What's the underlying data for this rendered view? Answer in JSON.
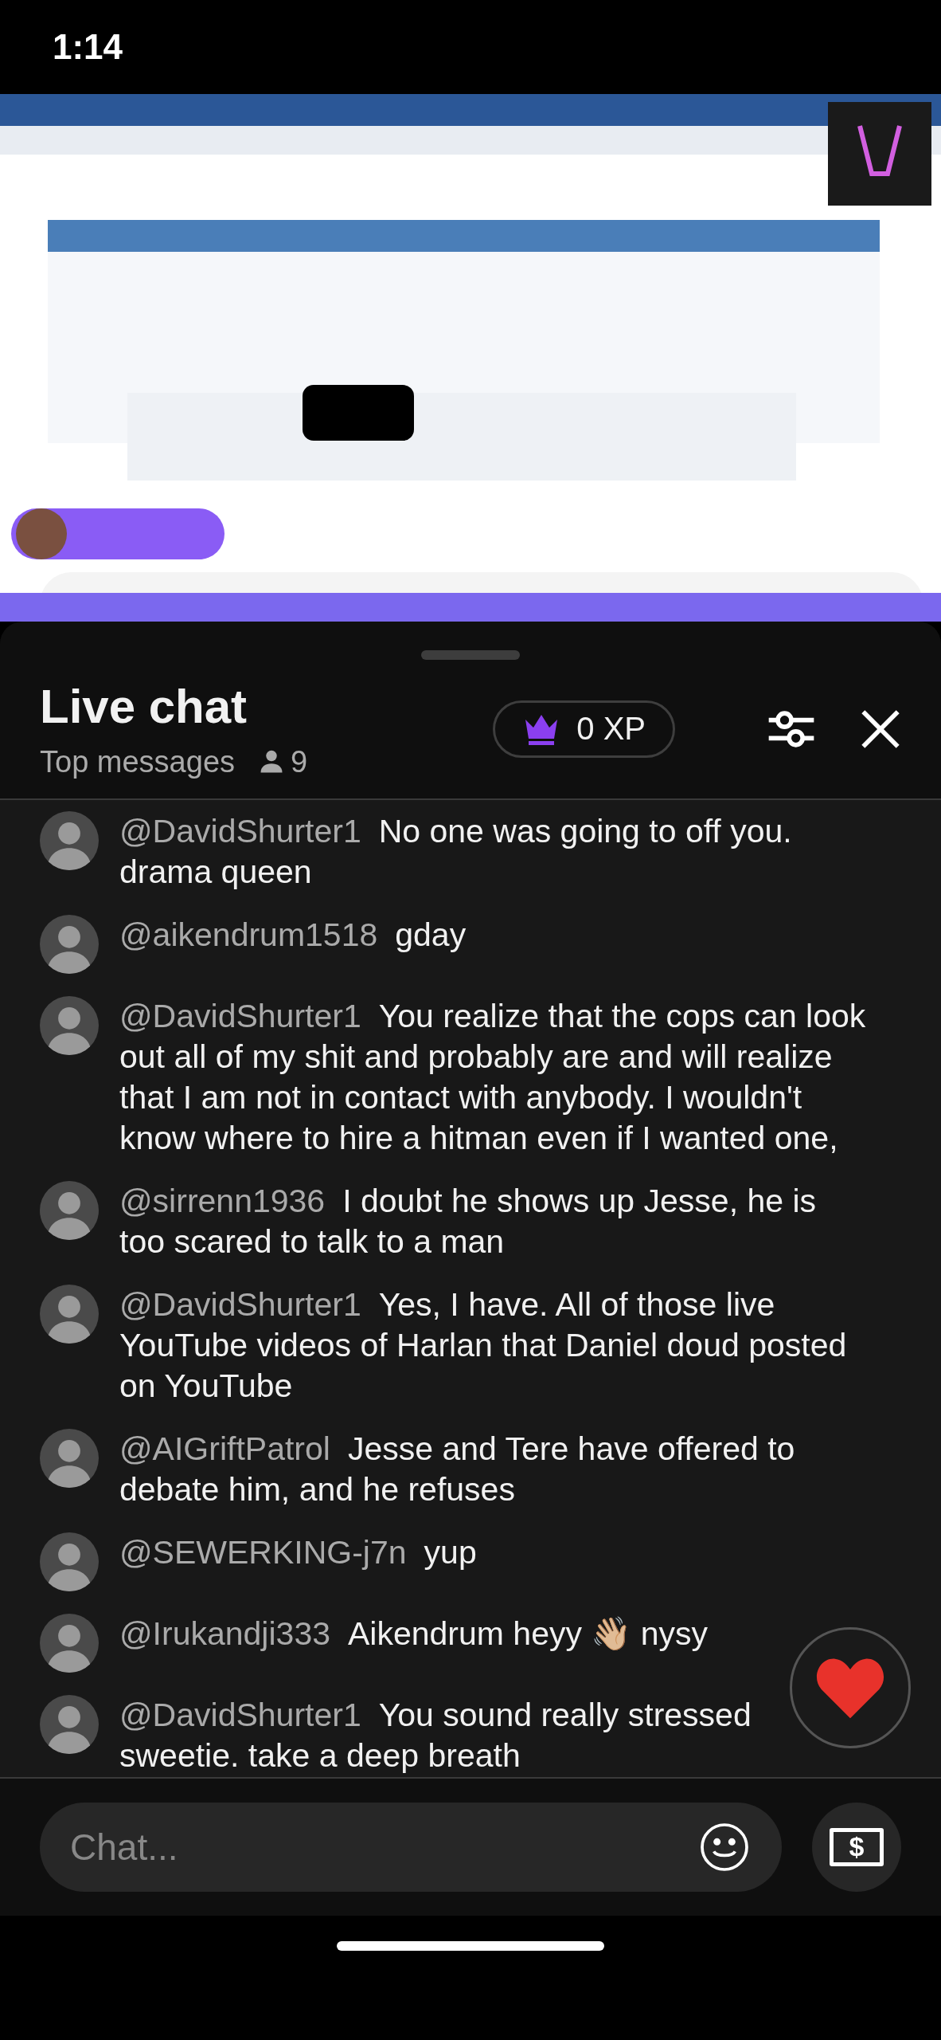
{
  "status_bar": {
    "time": "1:14"
  },
  "chat_panel": {
    "title": "Live chat",
    "mode": "Top messages",
    "viewer_count": "9",
    "xp_badge": "0 XP"
  },
  "messages": [
    {
      "author": "@DavidShurter1",
      "text": "No one was going to off you. drama queen"
    },
    {
      "author": "@aikendrum1518",
      "text": "gday"
    },
    {
      "author": "@DavidShurter1",
      "text": "You realize that the cops can look out all of my shit and probably are and will realize that I am not in contact with anybody. I wouldn't know where to hire a hitman even if I wanted one,"
    },
    {
      "author": "@sirrenn1936",
      "text": "I doubt he shows up Jesse, he is too scared to talk to a man"
    },
    {
      "author": "@DavidShurter1",
      "text": "Yes, I have. All of those live YouTube videos of Harlan that Daniel doud posted on YouTube"
    },
    {
      "author": "@AIGriftPatrol",
      "text": "Jesse and Tere have offered to debate him, and he refuses"
    },
    {
      "author": "@SEWERKING-j7n",
      "text": "yup"
    },
    {
      "author": "@Irukandji333",
      "text": "Aikendrum heyy 👋🏼 nysy"
    },
    {
      "author": "@DavidShurter1",
      "text": "You sound really stressed sweetie. take a deep breath"
    }
  ],
  "composer": {
    "placeholder": "Chat...",
    "dollar_sign": "$"
  }
}
